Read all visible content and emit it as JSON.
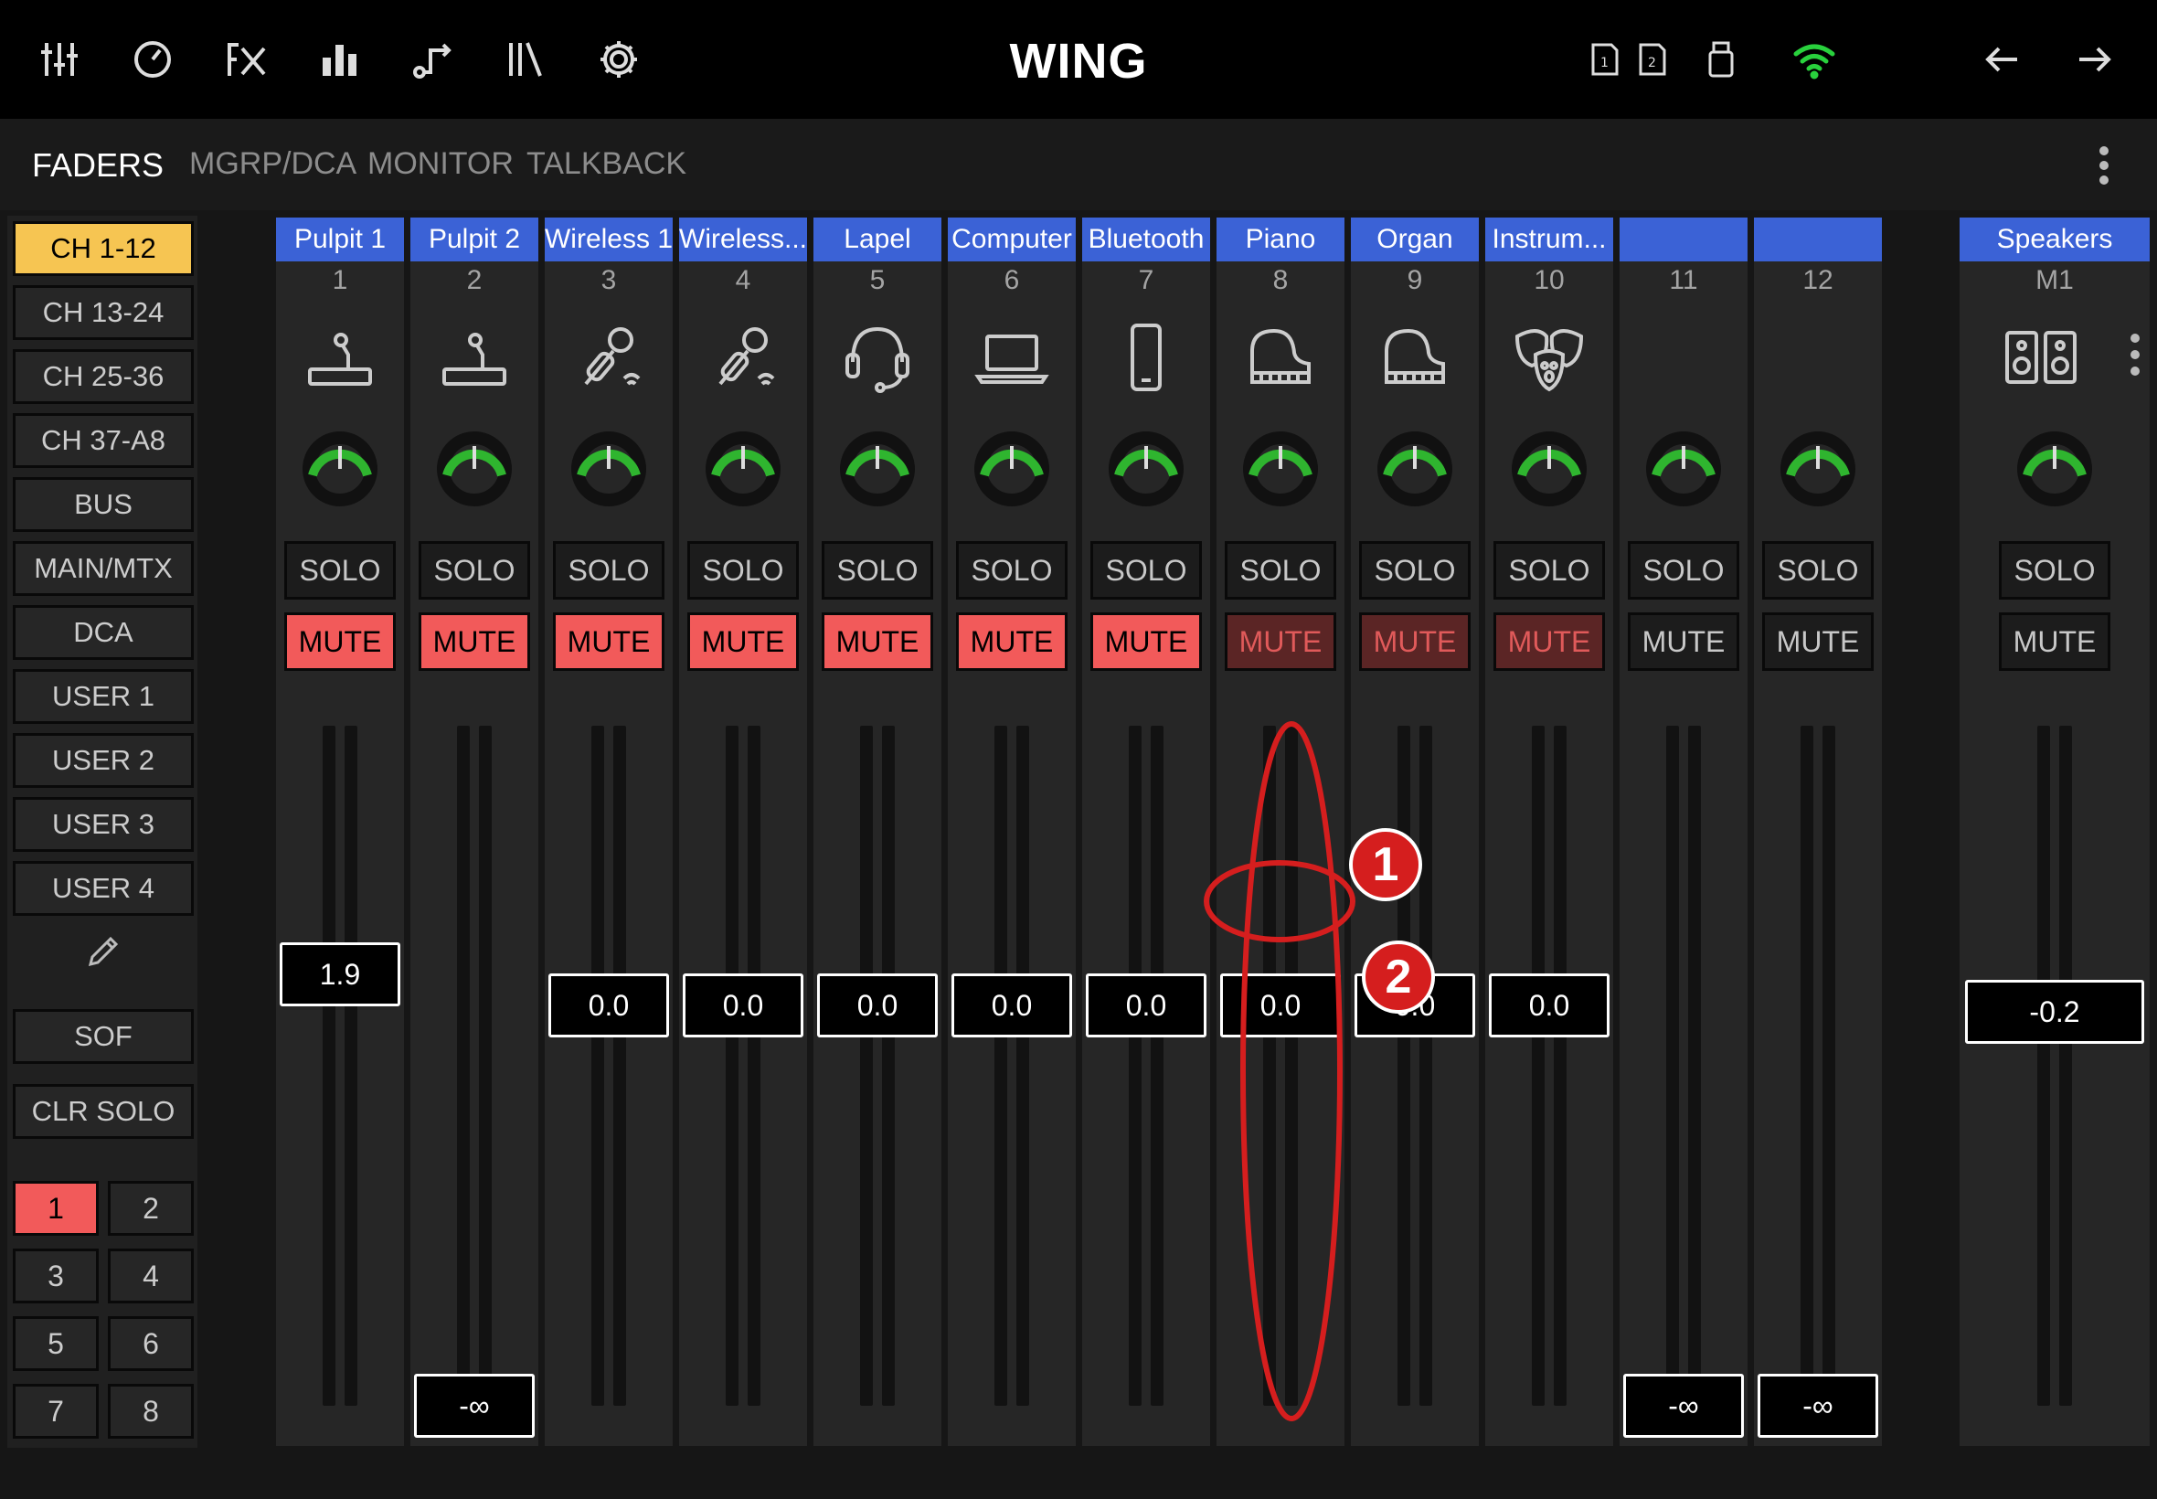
{
  "app": {
    "brand": "WING"
  },
  "toolbar": {
    "left_icons": [
      "mixer-icon",
      "meter-icon",
      "fx-icon",
      "bars-icon",
      "routing-icon",
      "library-icon",
      "settings-icon"
    ],
    "right_icons": [
      "card-1-icon",
      "card-2-icon",
      "usb-icon",
      "wifi-icon",
      "back-arrow-icon",
      "forward-arrow-icon"
    ],
    "wifi_color": "#29d13d"
  },
  "tabs": [
    {
      "label": "FADERS",
      "active": true
    },
    {
      "label": "MGRP/DCA",
      "active": false
    },
    {
      "label": "MONITOR",
      "active": false
    },
    {
      "label": "TALKBACK",
      "active": false
    }
  ],
  "left_panel": {
    "layers": [
      {
        "label": "CH 1-12",
        "active": true
      },
      {
        "label": "CH 13-24",
        "active": false
      },
      {
        "label": "CH 25-36",
        "active": false
      },
      {
        "label": "CH 37-A8",
        "active": false
      },
      {
        "label": "BUS",
        "active": false
      },
      {
        "label": "MAIN/MTX",
        "active": false
      },
      {
        "label": "DCA",
        "active": false
      },
      {
        "label": "USER 1",
        "active": false
      },
      {
        "label": "USER 2",
        "active": false
      },
      {
        "label": "USER 3",
        "active": false
      },
      {
        "label": "USER 4",
        "active": false
      }
    ],
    "sof_label": "SOF",
    "clr_solo_label": "CLR SOLO",
    "banks": [
      "1",
      "2",
      "3",
      "4",
      "5",
      "6",
      "7",
      "8"
    ],
    "active_bank": "1"
  },
  "channels": [
    {
      "name": "Pulpit 1",
      "number": "1",
      "icon": "podium-mic-icon",
      "solo": "SOLO",
      "mute": "MUTE",
      "mute_state": "on",
      "fader": "1.9",
      "fader_level": 0.7
    },
    {
      "name": "Pulpit 2",
      "number": "2",
      "icon": "podium-mic-icon",
      "solo": "SOLO",
      "mute": "MUTE",
      "mute_state": "on",
      "fader": "-∞",
      "fader_level": 0.0
    },
    {
      "name": "Wireless 1",
      "number": "3",
      "icon": "wireless-mic-icon",
      "solo": "SOLO",
      "mute": "MUTE",
      "mute_state": "on",
      "fader": "0.0",
      "fader_level": 0.65
    },
    {
      "name": "Wireless...",
      "number": "4",
      "icon": "wireless-mic-icon",
      "solo": "SOLO",
      "mute": "MUTE",
      "mute_state": "on",
      "fader": "0.0",
      "fader_level": 0.65
    },
    {
      "name": "Lapel",
      "number": "5",
      "icon": "headset-icon",
      "solo": "SOLO",
      "mute": "MUTE",
      "mute_state": "on",
      "fader": "0.0",
      "fader_level": 0.65
    },
    {
      "name": "Computer",
      "number": "6",
      "icon": "laptop-icon",
      "solo": "SOLO",
      "mute": "MUTE",
      "mute_state": "on",
      "fader": "0.0",
      "fader_level": 0.65
    },
    {
      "name": "Bluetooth",
      "number": "7",
      "icon": "phone-icon",
      "solo": "SOLO",
      "mute": "MUTE",
      "mute_state": "on",
      "fader": "0.0",
      "fader_level": 0.65
    },
    {
      "name": "Piano",
      "number": "8",
      "icon": "piano-icon",
      "solo": "SOLO",
      "mute": "MUTE",
      "mute_state": "dim",
      "fader": "0.0",
      "fader_level": 0.65
    },
    {
      "name": "Organ",
      "number": "9",
      "icon": "piano-icon",
      "solo": "SOLO",
      "mute": "MUTE",
      "mute_state": "dim",
      "fader": "0.0",
      "fader_level": 0.65
    },
    {
      "name": "Instrum...",
      "number": "10",
      "icon": "theater-masks-icon",
      "solo": "SOLO",
      "mute": "MUTE",
      "mute_state": "dim",
      "fader": "0.0",
      "fader_level": 0.65
    },
    {
      "name": "",
      "number": "11",
      "icon": "",
      "solo": "SOLO",
      "mute": "MUTE",
      "mute_state": "off",
      "fader": "-∞",
      "fader_level": 0.0
    },
    {
      "name": "",
      "number": "12",
      "icon": "",
      "solo": "SOLO",
      "mute": "MUTE",
      "mute_state": "off",
      "fader": "-∞",
      "fader_level": 0.0
    }
  ],
  "main_channel": {
    "name": "Speakers",
    "number": "M1",
    "icon": "speakers-icon",
    "solo": "SOLO",
    "mute": "MUTE",
    "mute_state": "off",
    "fader": "-0.2",
    "fader_level": 0.64
  },
  "colors": {
    "mute_on": "#f25a5a",
    "mute_dim": "#5b2525",
    "layer_active": "#f6c552",
    "name_bar": "#3b62d6",
    "knob_ring": "#2fb52f",
    "annotation": "#d51e1e"
  },
  "annotations": {
    "markers": [
      "1",
      "2"
    ]
  }
}
